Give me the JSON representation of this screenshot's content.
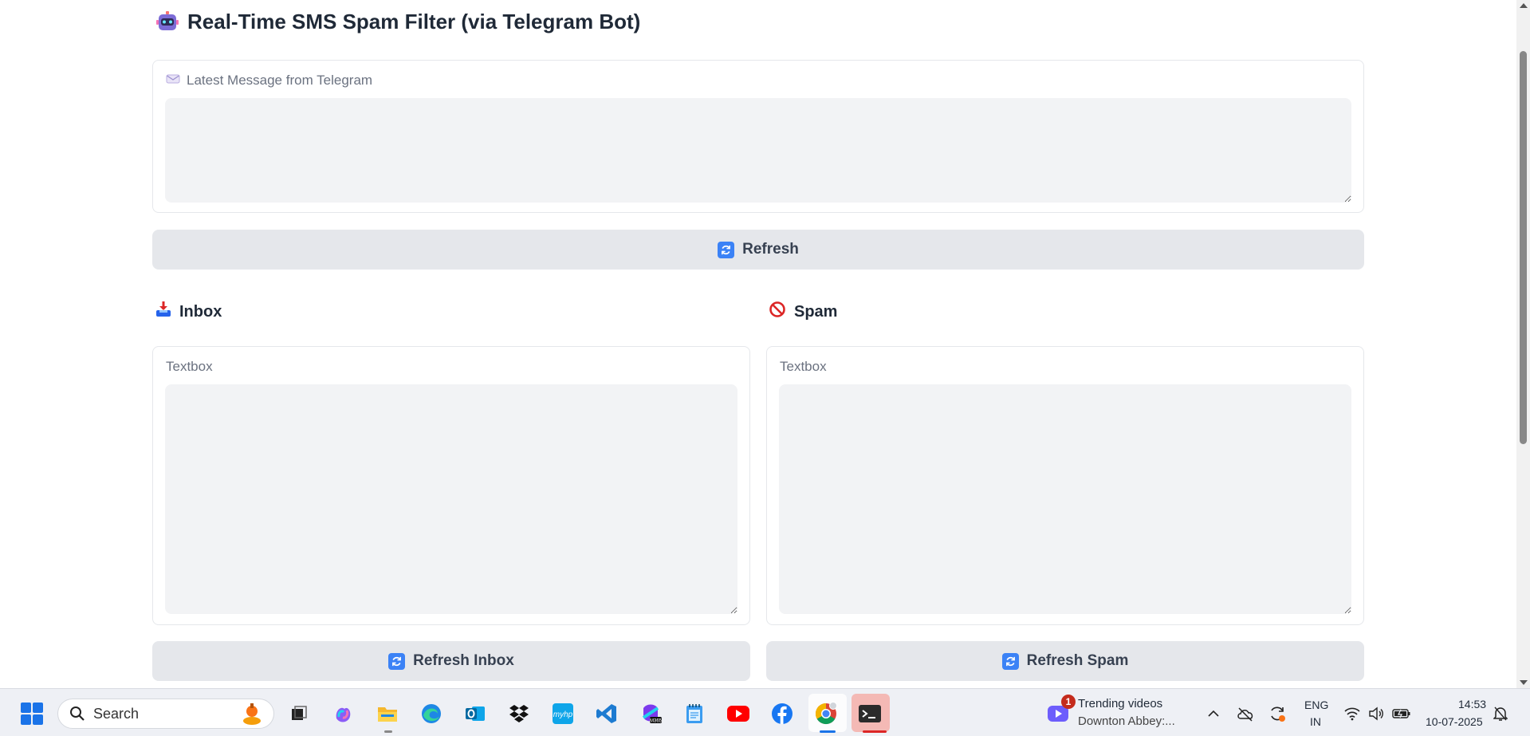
{
  "header": {
    "icon": "robot-icon",
    "title": "Real-Time SMS Spam Filter (via Telegram Bot)"
  },
  "latest": {
    "label": "Latest Message from Telegram",
    "icon": "envelope-icon",
    "value": ""
  },
  "refresh_button": {
    "label": "Refresh",
    "icon": "refresh-icon"
  },
  "inbox": {
    "heading": "Inbox",
    "icon": "inbox-tray-icon",
    "textbox_label": "Textbox",
    "value": "",
    "refresh_label": "Refresh Inbox"
  },
  "spam": {
    "heading": "Spam",
    "icon": "prohibited-icon",
    "textbox_label": "Textbox",
    "value": "",
    "refresh_label": "Refresh Spam"
  },
  "taskbar": {
    "search_label": "Search",
    "apps": [
      "task-view",
      "copilot",
      "file-explorer",
      "edge",
      "outlook",
      "dropbox",
      "myhp",
      "vscode",
      "m365",
      "notepad",
      "youtube",
      "facebook",
      "chrome",
      "terminal"
    ],
    "widget": {
      "badge": "1",
      "title": "Trending videos",
      "subtitle": "Downton Abbey:..."
    },
    "language": {
      "line1": "ENG",
      "line2": "IN"
    },
    "clock": {
      "time": "14:53",
      "date": "10-07-2025"
    }
  },
  "colors": {
    "accent": "#3b82f6",
    "field_bg": "#f2f3f5",
    "button_bg": "#e5e7eb",
    "spam_red": "#dc2626"
  }
}
